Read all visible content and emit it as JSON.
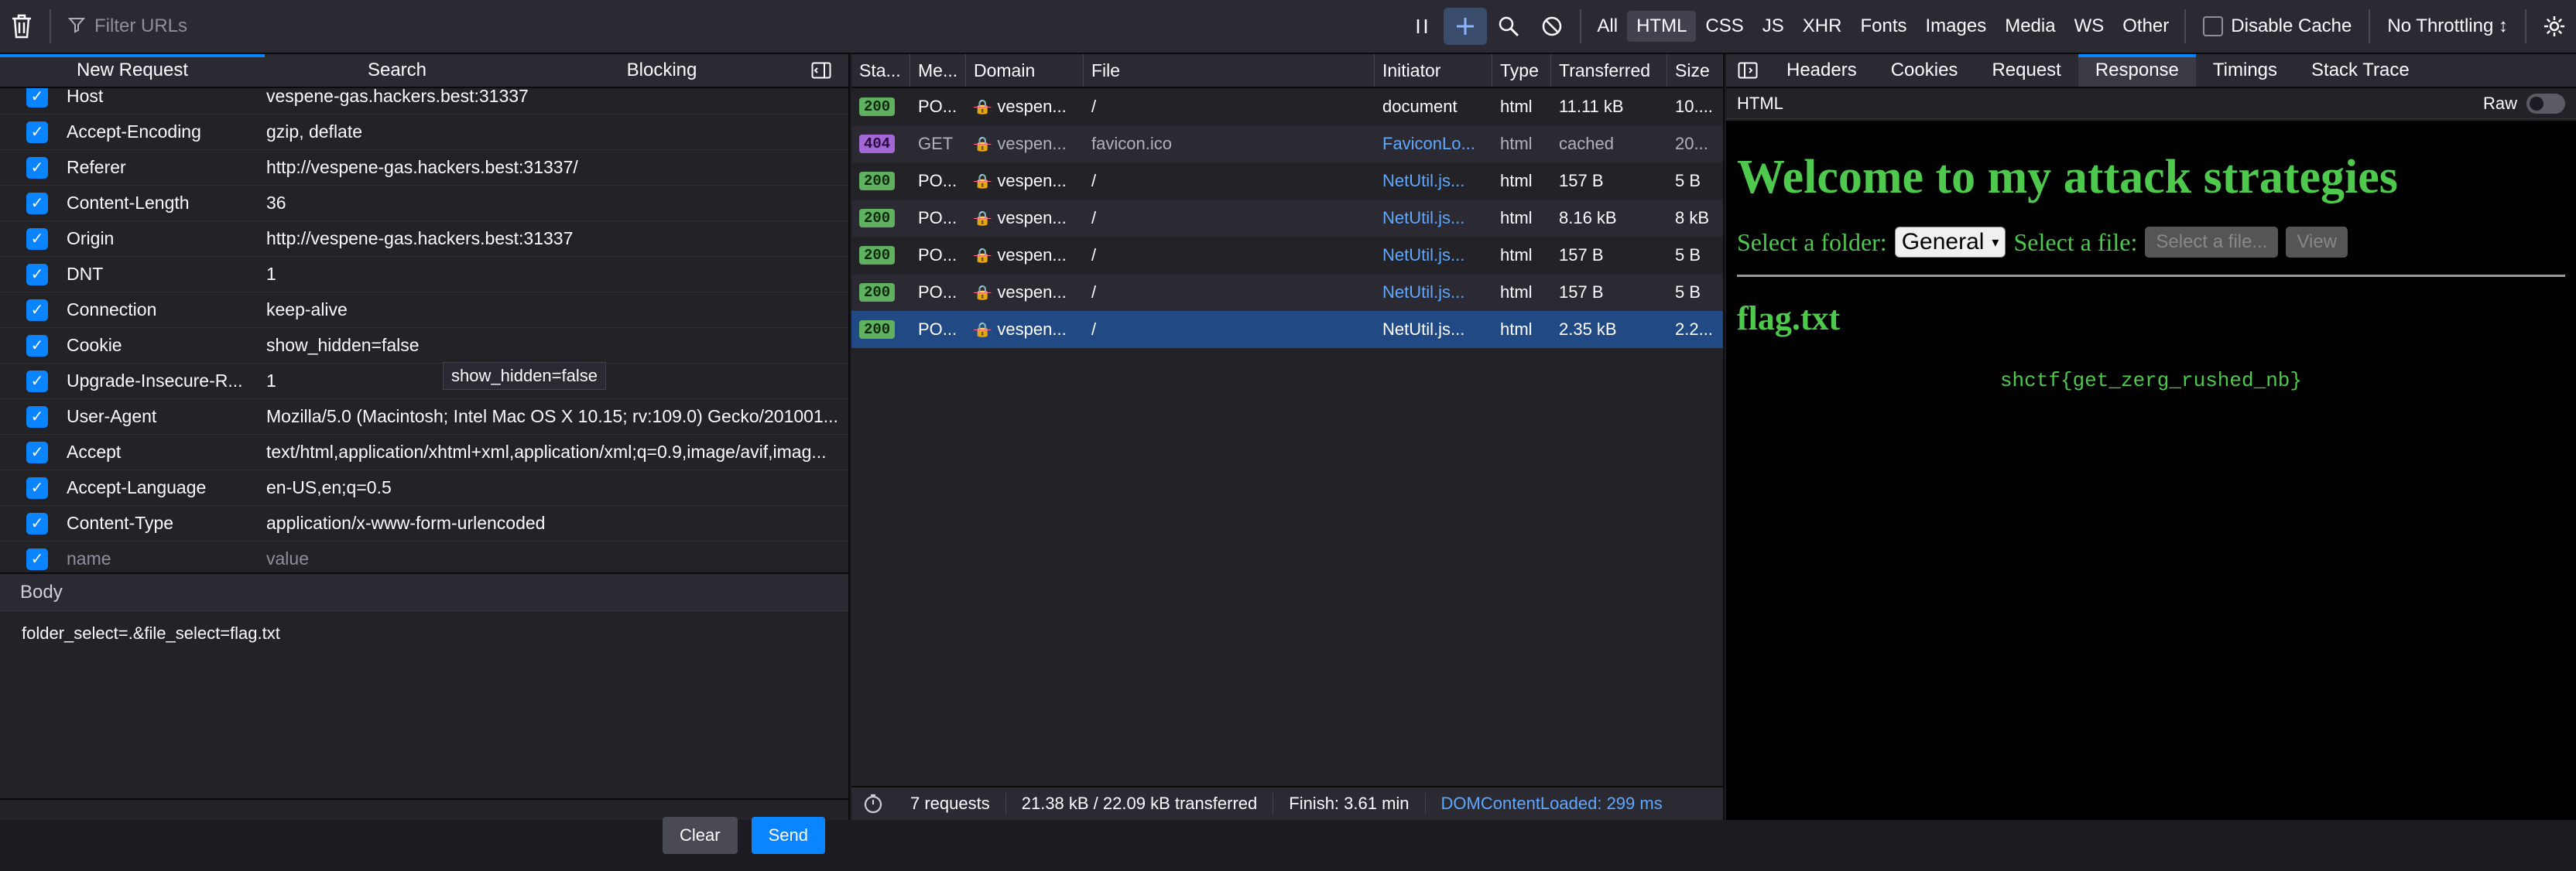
{
  "toolbar": {
    "filter_placeholder": "Filter URLs",
    "type_filters": [
      "All",
      "HTML",
      "CSS",
      "JS",
      "XHR",
      "Fonts",
      "Images",
      "Media",
      "WS",
      "Other"
    ],
    "active_type_filter": "HTML",
    "disable_cache_label": "Disable Cache",
    "throttle_label": "No Throttling ↕",
    "icons": [
      "trash-icon",
      "filter-icon",
      "pause-icon",
      "plus-icon",
      "search-icon",
      "block-icon",
      "settings-icon"
    ]
  },
  "left_panel": {
    "tabs": [
      "New Request",
      "Search",
      "Blocking"
    ],
    "active_tab": "New Request",
    "headers": [
      {
        "name": "Host",
        "value": "vespene-gas.hackers.best:31337",
        "checked": true
      },
      {
        "name": "Accept-Encoding",
        "value": "gzip, deflate",
        "checked": true
      },
      {
        "name": "Referer",
        "value": "http://vespene-gas.hackers.best:31337/",
        "checked": true
      },
      {
        "name": "Content-Length",
        "value": "36",
        "checked": true
      },
      {
        "name": "Origin",
        "value": "http://vespene-gas.hackers.best:31337",
        "checked": true
      },
      {
        "name": "DNT",
        "value": "1",
        "checked": true
      },
      {
        "name": "Connection",
        "value": "keep-alive",
        "checked": true
      },
      {
        "name": "Cookie",
        "value": "show_hidden=false",
        "checked": true
      },
      {
        "name": "Upgrade-Insecure-R...",
        "value": "1",
        "checked": true
      },
      {
        "name": "User-Agent",
        "value": "Mozilla/5.0 (Macintosh; Intel Mac OS X 10.15; rv:109.0) Gecko/201001...",
        "checked": true
      },
      {
        "name": "Accept",
        "value": "text/html,application/xhtml+xml,application/xml;q=0.9,image/avif,imag...",
        "checked": true
      },
      {
        "name": "Accept-Language",
        "value": "en-US,en;q=0.5",
        "checked": true
      },
      {
        "name": "Content-Type",
        "value": "application/x-www-form-urlencoded",
        "checked": true
      }
    ],
    "new_header_placeholder": {
      "name": "name",
      "value": "value"
    },
    "tooltip": "show_hidden=false",
    "body_label": "Body",
    "body_text": "folder_select=.&file_select=flag.txt",
    "clear_label": "Clear",
    "send_label": "Send"
  },
  "requests": {
    "columns": [
      "Sta...",
      "Me...",
      "Domain",
      "File",
      "Initiator",
      "Type",
      "Transferred",
      "Size"
    ],
    "rows": [
      {
        "status": "200",
        "method": "PO...",
        "domain": "vespen...",
        "file": "/",
        "initiator": "document",
        "initiator_link": false,
        "type": "html",
        "transferred": "11.11 kB",
        "size": "10...."
      },
      {
        "status": "404",
        "method": "GET",
        "domain": "vespen...",
        "file": "favicon.ico",
        "initiator": "FaviconLo...",
        "initiator_link": true,
        "type": "html",
        "transferred": "cached",
        "size": "20..."
      },
      {
        "status": "200",
        "method": "PO...",
        "domain": "vespen...",
        "file": "/",
        "initiator": "NetUtil.js...",
        "initiator_link": true,
        "type": "html",
        "transferred": "157 B",
        "size": "5 B"
      },
      {
        "status": "200",
        "method": "PO...",
        "domain": "vespen...",
        "file": "/",
        "initiator": "NetUtil.js...",
        "initiator_link": true,
        "type": "html",
        "transferred": "8.16 kB",
        "size": "8 kB"
      },
      {
        "status": "200",
        "method": "PO...",
        "domain": "vespen...",
        "file": "/",
        "initiator": "NetUtil.js...",
        "initiator_link": true,
        "type": "html",
        "transferred": "157 B",
        "size": "5 B"
      },
      {
        "status": "200",
        "method": "PO...",
        "domain": "vespen...",
        "file": "/",
        "initiator": "NetUtil.js...",
        "initiator_link": true,
        "type": "html",
        "transferred": "157 B",
        "size": "5 B"
      },
      {
        "status": "200",
        "method": "PO...",
        "domain": "vespen...",
        "file": "/",
        "initiator": "NetUtil.js...",
        "initiator_link": true,
        "type": "html",
        "transferred": "2.35 kB",
        "size": "2.2..."
      }
    ],
    "selected_index": 6,
    "footer": {
      "requests": "7 requests",
      "transferred": "21.38 kB / 22.09 kB transferred",
      "finish": "Finish: 3.61 min",
      "dom_loaded": "DOMContentLoaded: 299 ms"
    }
  },
  "right_panel": {
    "tabs": [
      "Headers",
      "Cookies",
      "Request",
      "Response",
      "Timings",
      "Stack Trace"
    ],
    "active_tab": "Response",
    "html_label": "HTML",
    "raw_label": "Raw",
    "preview": {
      "heading": "Welcome to my attack strategies",
      "folder_label": "Select a folder:",
      "folder_value": "General",
      "file_label": "Select a file:",
      "file_placeholder": "Select a file...",
      "view_button": "View",
      "file_title": "flag.txt",
      "flag_text": "shctf{get_zerg_rushed_nb}"
    }
  }
}
